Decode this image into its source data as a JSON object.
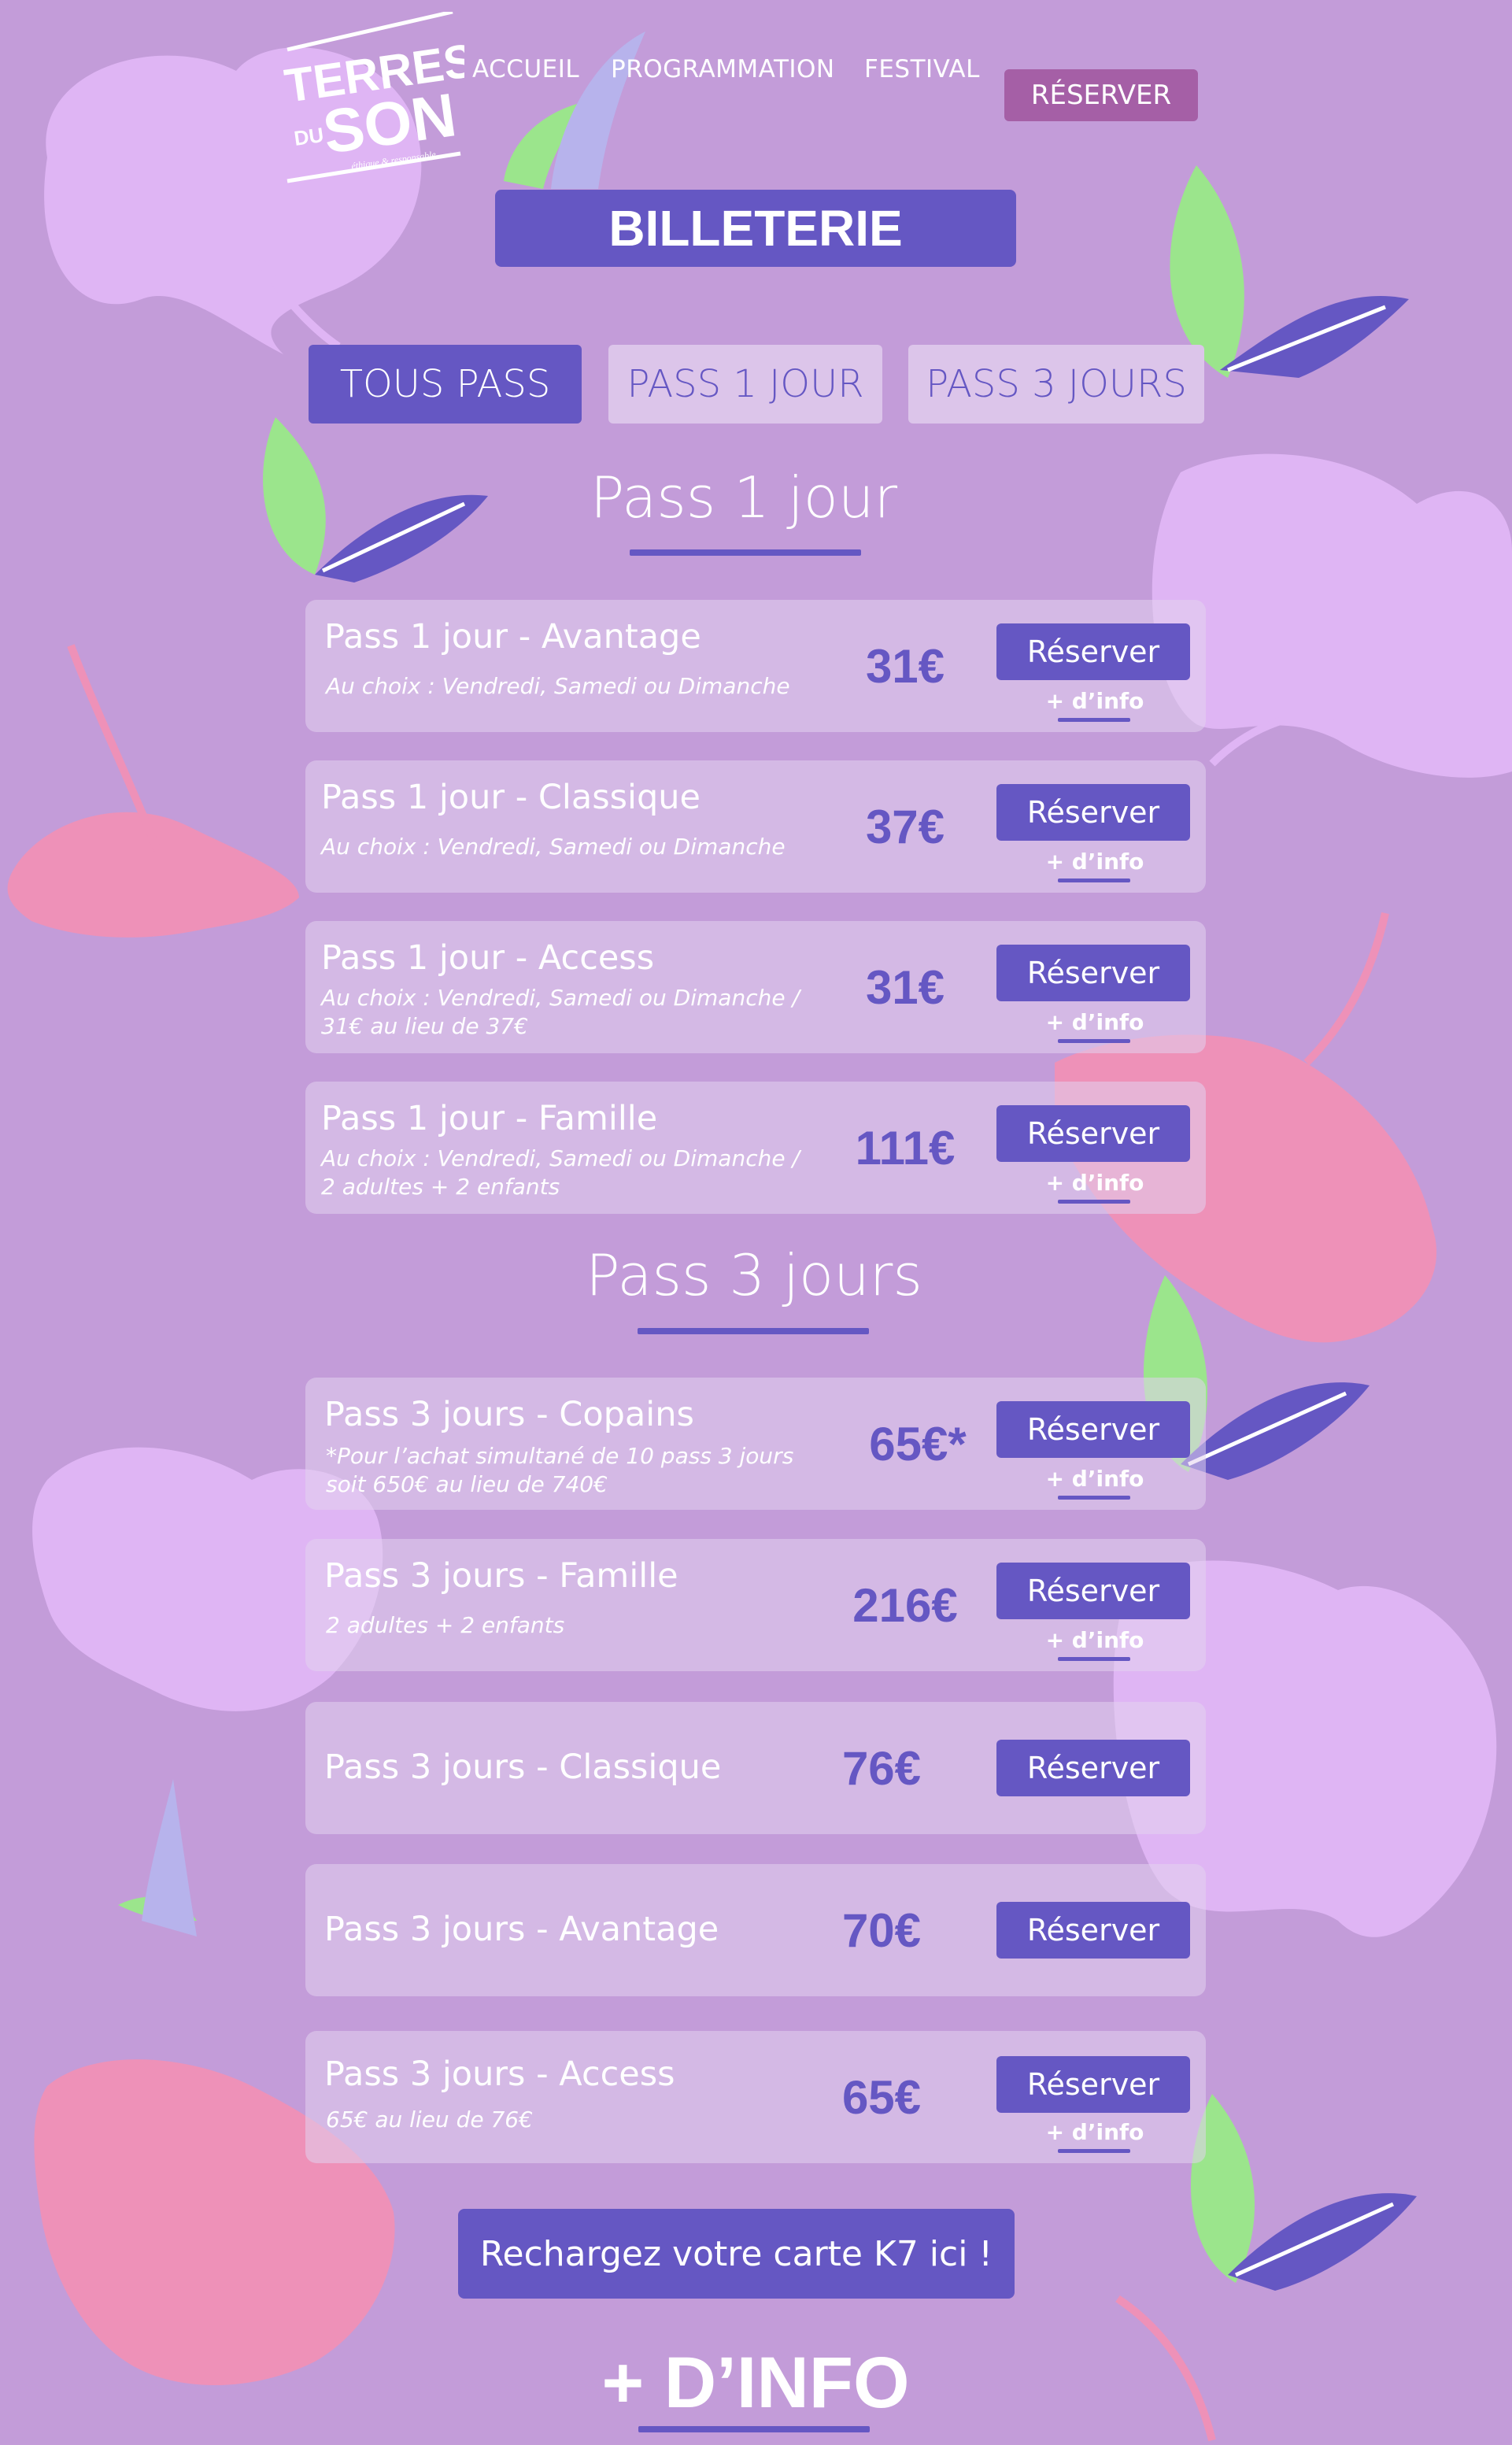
{
  "brand": {
    "logo_line1": "TERRES",
    "logo_line2": "DU",
    "logo_line3": "SON",
    "logo_tagline": "éthique & responsable"
  },
  "nav": {
    "items": [
      "ACCUEIL",
      "PROGRAMMATION",
      "FESTIVAL"
    ],
    "cta": "RÉSERVER"
  },
  "page_title": "BILLETERIE",
  "tabs": [
    "TOUS PASS",
    "PASS 1 JOUR",
    "PASS 3 JOURS"
  ],
  "active_tab": "TOUS PASS",
  "sections": [
    {
      "title": "Pass 1 jour",
      "items": [
        {
          "name": "Pass 1 jour - Avantage",
          "sub1": "Au choix : Vendredi, Samedi ou Dimanche",
          "sub2": "",
          "price": "31€",
          "button": "Réserver",
          "info": "+ d’info"
        },
        {
          "name": "Pass 1 jour - Classique",
          "sub1": "Au choix : Vendredi, Samedi ou Dimanche",
          "sub2": "",
          "price": "37€",
          "button": "Réserver",
          "info": "+ d’info"
        },
        {
          "name": "Pass 1 jour - Access",
          "sub1": "Au choix : Vendredi, Samedi ou Dimanche /",
          "sub2": "31€ au lieu de 37€",
          "price": "31€",
          "button": "Réserver",
          "info": "+ d’info"
        },
        {
          "name": "Pass 1 jour - Famille",
          "sub1": "Au choix : Vendredi, Samedi ou Dimanche /",
          "sub2": "2 adultes + 2 enfants",
          "price": "111€",
          "button": "Réserver",
          "info": "+ d’info"
        }
      ]
    },
    {
      "title": "Pass 3 jours",
      "items": [
        {
          "name": "Pass 3 jours - Copains",
          "sub1": "*Pour l’achat simultané de 10 pass 3 jours",
          "sub2": "soit 650€ au lieu de 740€",
          "price": "65€*",
          "button": "Réserver",
          "info": "+ d’info"
        },
        {
          "name": "Pass 3 jours - Famille",
          "sub1": "2 adultes + 2 enfants",
          "sub2": "",
          "price": "216€",
          "button": "Réserver",
          "info": "+ d’info"
        },
        {
          "name": "Pass 3 jours - Classique",
          "sub1": "",
          "sub2": "",
          "price": "76€",
          "button": "Réserver",
          "info": ""
        },
        {
          "name": "Pass 3 jours - Avantage",
          "sub1": "",
          "sub2": "",
          "price": "70€",
          "button": "Réserver",
          "info": ""
        },
        {
          "name": "Pass 3 jours - Access",
          "sub1": "65€ au lieu de 76€",
          "sub2": "",
          "price": "65€",
          "button": "Réserver",
          "info": "+ d’info"
        }
      ]
    }
  ],
  "cta_k7": "Rechargez votre carte K7 ici !",
  "more_info": "+ D’INFO",
  "colors": {
    "background": "#c39cd9",
    "primary": "#6557c3",
    "nav_cta": "#a55fa6",
    "tab_inactive": "#dcc5ea",
    "leaf_green": "#9be58c",
    "petal_pink": "#ee91b8",
    "petal_lilac": "#dfb5f4"
  }
}
